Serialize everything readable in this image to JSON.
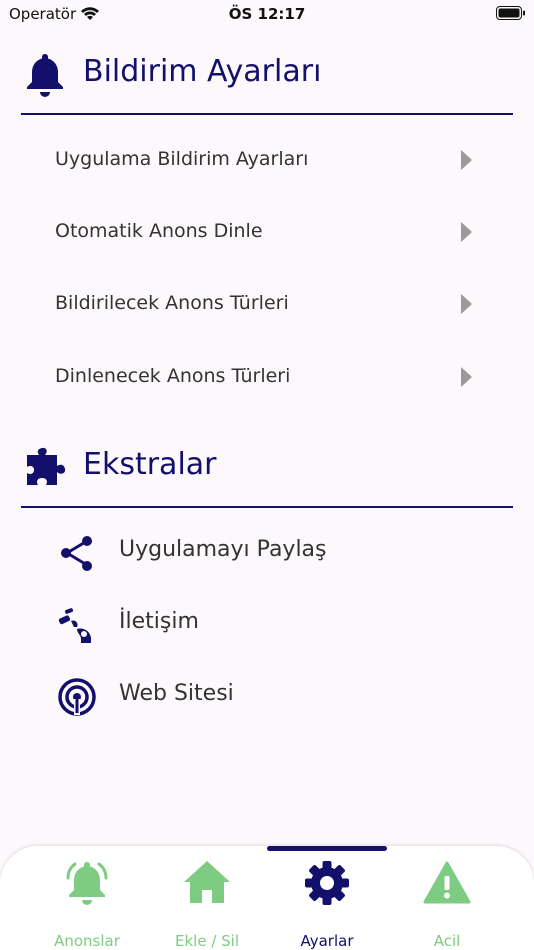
{
  "status_bar": {
    "carrier": "Operatör",
    "time": "ÖS 12:17"
  },
  "notifications": {
    "title": "Bildirim Ayarları",
    "items": [
      {
        "label": "Uygulama Bildirim Ayarları"
      },
      {
        "label": "Otomatik Anons Dinle"
      },
      {
        "label": "Bildirilecek Anons Türleri"
      },
      {
        "label": "Dinlenecek Anons Türleri"
      }
    ]
  },
  "extras": {
    "title": "Ekstralar",
    "items": [
      {
        "label": "Uygulamayı Paylaş",
        "icon": "share-icon"
      },
      {
        "label": "İletişim",
        "icon": "contact-icon"
      },
      {
        "label": "Web Sitesi",
        "icon": "website-icon"
      }
    ]
  },
  "tabs": {
    "active": "Ayarlar",
    "items": [
      {
        "label": "Anonslar",
        "icon": "bell-icon",
        "color": "#7ecb82"
      },
      {
        "label": "Ekle / Sil",
        "icon": "home-icon",
        "color": "#7ecb82"
      },
      {
        "label": "Ayarlar",
        "icon": "gear-icon",
        "color": "#12106b"
      },
      {
        "label": "Acil",
        "icon": "warning-icon",
        "color": "#7ecb82"
      }
    ]
  },
  "colors": {
    "accent": "#12106b",
    "tab_inactive": "#7ecb82",
    "background": "#fcf8fc"
  }
}
